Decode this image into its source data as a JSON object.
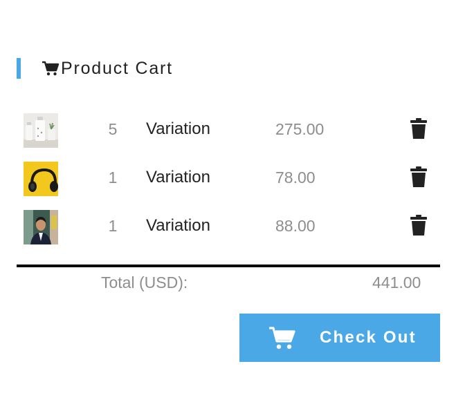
{
  "cart": {
    "title": "Product Cart",
    "icon": "shopping-cart-icon",
    "accent_color": "#4aa8e6"
  },
  "items": [
    {
      "image": "vases-thumbnail",
      "quantity": "5",
      "name": "Variation",
      "price": "275.00",
      "remove_icon": "trash-icon"
    },
    {
      "image": "headphones-thumbnail",
      "quantity": "1",
      "name": "Variation",
      "price": "78.00",
      "remove_icon": "trash-icon"
    },
    {
      "image": "portrait-thumbnail",
      "quantity": "1",
      "name": "Variation",
      "price": "88.00",
      "remove_icon": "trash-icon"
    }
  ],
  "summary": {
    "total_label": "Total (USD):",
    "total_value": "441.00"
  },
  "checkout": {
    "label": "Check Out",
    "icon": "shopping-cart-icon",
    "color": "#4aa8e6"
  }
}
